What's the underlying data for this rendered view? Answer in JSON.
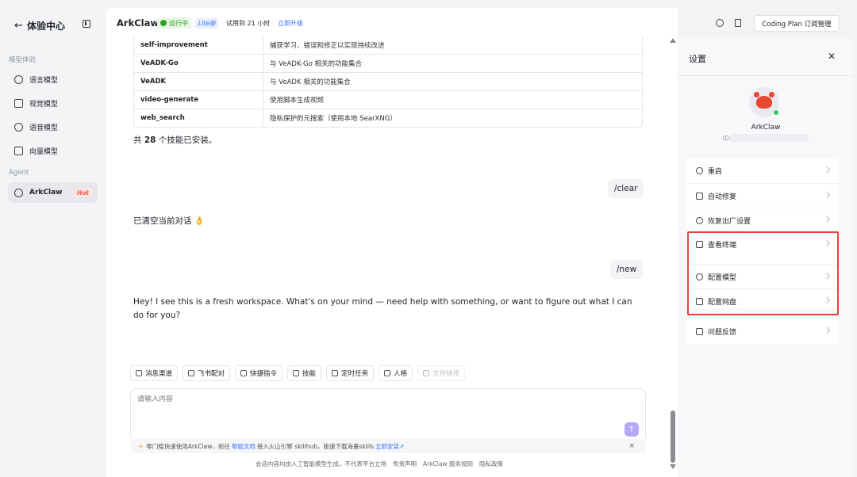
{
  "sidebar": {
    "back_icon": "arrow-left-icon",
    "title": "体验中心",
    "section_models": "模型体验",
    "items": [
      {
        "label": "语言模型",
        "icon": "language-model-icon"
      },
      {
        "label": "视觉模型",
        "icon": "vision-model-icon"
      },
      {
        "label": "语音模型",
        "icon": "speech-model-icon"
      },
      {
        "label": "向量模型",
        "icon": "vector-model-icon"
      }
    ],
    "section_agent": "Agent",
    "agent_item": {
      "label": "ArkClaw",
      "badge": "Hot",
      "icon": "arkclaw-icon"
    }
  },
  "header": {
    "app_name": "ArkClaw",
    "status": "运行中",
    "edition": "Lite版",
    "trial": "试用到 21 小时",
    "upgrade": "立即升级",
    "plan_button": "Coding Plan 订阅管理"
  },
  "skills_table": [
    {
      "name": "self-improvement",
      "desc": "捕获学习、错误和修正以实现持续改进"
    },
    {
      "name": "VeADK-Go",
      "desc": "与 VeADK-Go 相关的功能集合"
    },
    {
      "name": "VeADK",
      "desc": "与 VeADK 相关的功能集合"
    },
    {
      "name": "video-generate",
      "desc": "使用脚本生成视频"
    },
    {
      "name": "web_search",
      "desc": "隐私保护的元搜索（使用本地 SearXNG）"
    }
  ],
  "summary": {
    "prefix": "共 ",
    "count": "28",
    "suffix": " 个技能已安装。"
  },
  "messages": {
    "user1": "/clear",
    "bot1": "已清空当前对话 👌",
    "user2": "/new",
    "bot2": "Hey! I see this is a fresh workspace. What's on your mind — need help with something, or want to figure out what I can do for you?"
  },
  "chips": [
    {
      "label": "消息渠道",
      "disabled": false
    },
    {
      "label": "飞书配对",
      "disabled": false
    },
    {
      "label": "快捷指令",
      "disabled": false
    },
    {
      "label": "技能",
      "disabled": false
    },
    {
      "label": "定时任务",
      "disabled": false
    },
    {
      "label": "人格",
      "disabled": false
    },
    {
      "label": "文件快传",
      "disabled": true
    }
  ],
  "composer": {
    "placeholder": "请输入内容"
  },
  "tip": {
    "part1": "零门槛快速使用ArkClaw，前往",
    "link1": "帮助文档",
    "part2": "接入火山引擎 skillhub，极速下载海量skills",
    "link2": "立即安装↗"
  },
  "footer": {
    "disclaimer": "会话内容均由人工智能模型生成，不代表平台立场",
    "links": [
      "免责声明",
      "ArkClaw 服务规则",
      "隐私政策"
    ]
  },
  "settings": {
    "title": "设置",
    "name": "ArkClaw",
    "id_label": "ID:",
    "group1": [
      "重启",
      "自动修复",
      "恢复出厂设置"
    ],
    "group2": [
      "查看终端",
      "配置模型",
      "配置网盘"
    ],
    "group3": [
      "问题反馈"
    ]
  },
  "colors": {
    "accent": "#3370ff",
    "highlight": "#e0453f",
    "running": "#2ea121",
    "hot": "#f05a4a"
  }
}
